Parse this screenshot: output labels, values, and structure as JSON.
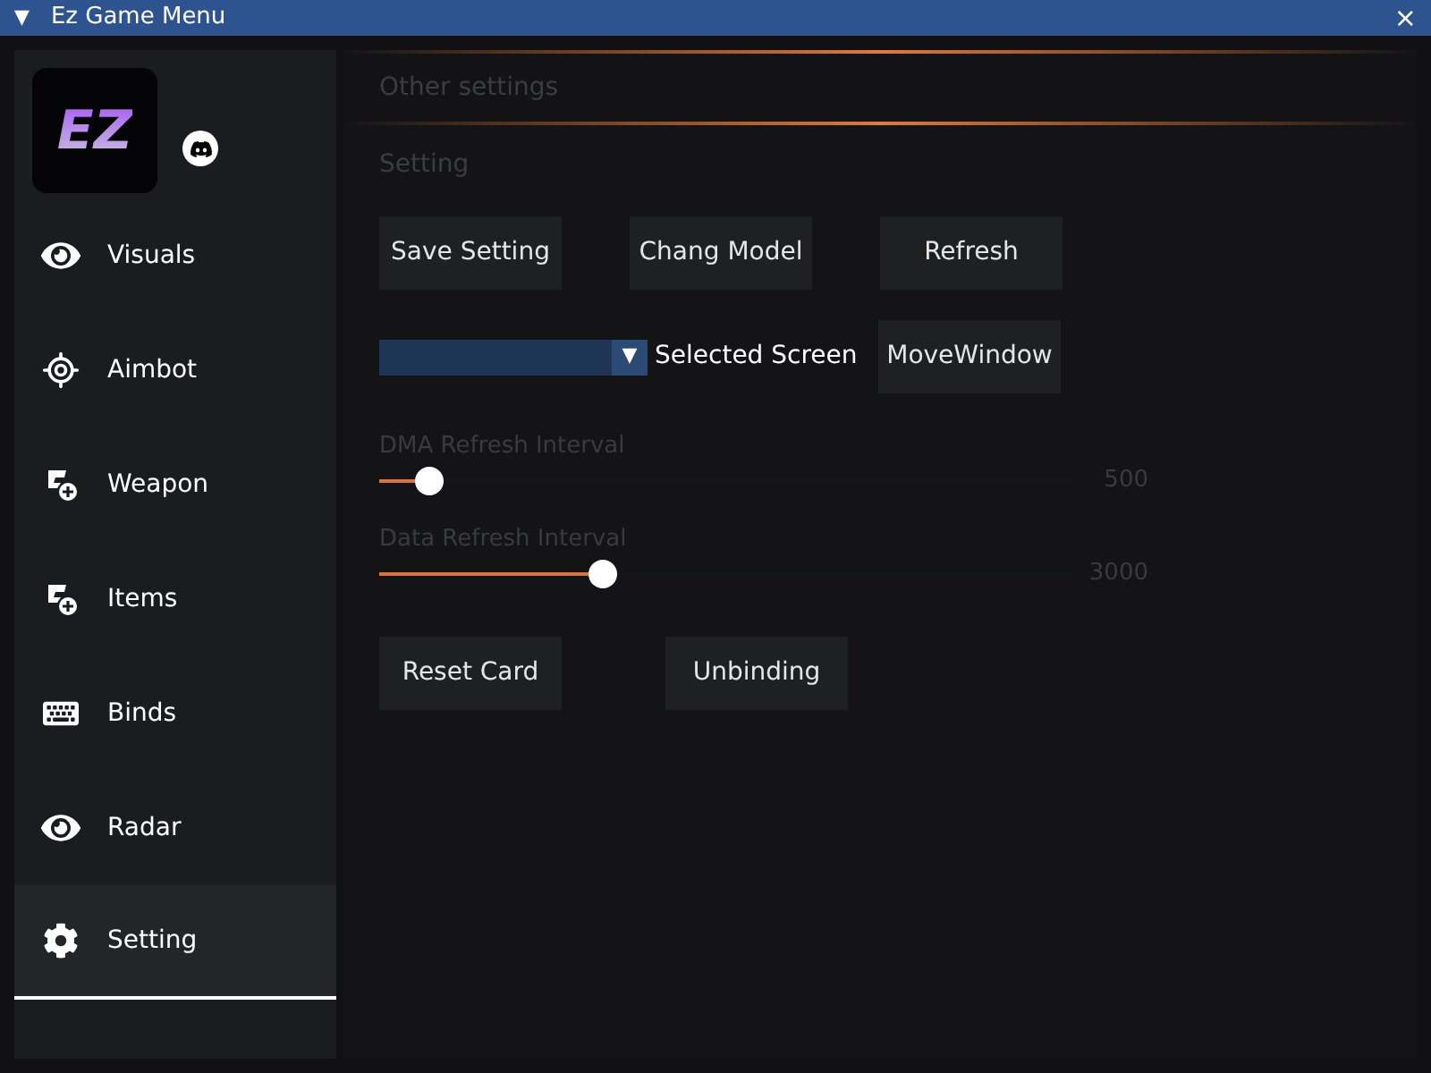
{
  "window": {
    "title": "Ez Game Menu",
    "collapse_glyph": "▼",
    "close_glyph": "×"
  },
  "logo": {
    "text": "EZ"
  },
  "sidebar": {
    "items": [
      {
        "label": "Visuals",
        "selected": false
      },
      {
        "label": "Aimbot",
        "selected": false
      },
      {
        "label": "Weapon",
        "selected": false
      },
      {
        "label": "Items",
        "selected": false
      },
      {
        "label": "Binds",
        "selected": false
      },
      {
        "label": "Radar",
        "selected": false
      },
      {
        "label": "Setting",
        "selected": true
      }
    ]
  },
  "header": {
    "title": "Other settings"
  },
  "section": {
    "title": "Setting"
  },
  "buttons_row": [
    "Save Setting",
    "Chang Model",
    "Refresh"
  ],
  "screen_select": {
    "arrow": "▼",
    "label": "Selected Screen"
  },
  "move_button": "MoveWindow",
  "sliders": [
    {
      "label": "DMA Refresh Interval",
      "level": 0.05,
      "reading": "500"
    },
    {
      "label": "Data Refresh Interval",
      "level": 0.3,
      "reading": "3000"
    }
  ],
  "bottom_buttons": [
    "Reset Card",
    "Unbinding"
  ]
}
